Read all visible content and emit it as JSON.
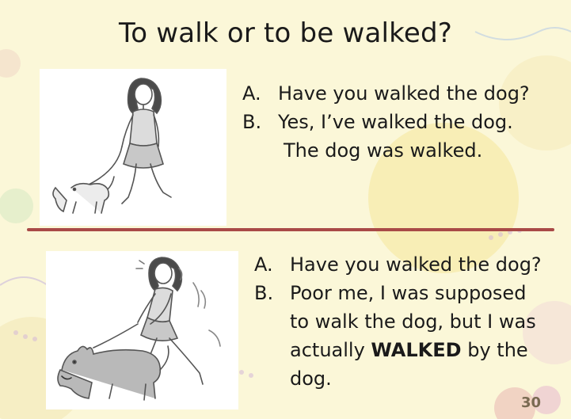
{
  "slide": {
    "title": "To walk or to be walked?",
    "page_number": "30"
  },
  "panel1": {
    "a_label": "A.",
    "a_text": "Have you walked the dog?",
    "b_label": "B.",
    "b_text": "Yes, I’ve walked the dog.",
    "b_continuation": "The dog was walked."
  },
  "panel2": {
    "a_label": "A.",
    "a_text": "Have you walked the dog?",
    "b_label": "B.",
    "b_line1": "Poor me, I was supposed",
    "b_line2": "to walk the dog, but I was",
    "b_line3_pre": "actually ",
    "b_line3_bold": "WALKED",
    "b_line3_post": " by the",
    "b_line4": "dog."
  },
  "colors": {
    "background": "#fbf7d8",
    "divider": "#a94a47",
    "text": "#1a1a1a"
  }
}
